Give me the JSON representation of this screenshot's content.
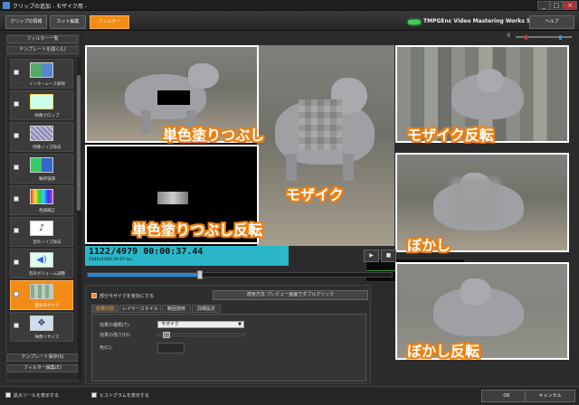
{
  "window": {
    "title": "クリップの追加 - モザイク用 -",
    "controls": [
      "_",
      "□",
      "×"
    ]
  },
  "header": {
    "tabs": [
      {
        "label": "クリップの情報",
        "active": false
      },
      {
        "label": "カット編集",
        "active": false
      },
      {
        "label": "フィルター",
        "active": true
      }
    ],
    "brand": "TMPGEnc Video Mastering Works 5",
    "help_label": "ヘルプ"
  },
  "sidebar": {
    "title": "フィルター一覧",
    "template_open_label": "テンプレートを開く(L)",
    "items": [
      {
        "label": "インターレース解除",
        "checked": false,
        "active": false,
        "thumb": "deinterlace"
      },
      {
        "label": "映像クロップ",
        "checked": false,
        "active": false,
        "thumb": "crop"
      },
      {
        "label": "映像ノイズ除去",
        "checked": false,
        "active": false,
        "thumb": "video-noise"
      },
      {
        "label": "輪郭強調",
        "checked": false,
        "active": false,
        "thumb": "sharpen"
      },
      {
        "label": "色調補正",
        "checked": false,
        "active": false,
        "thumb": "color"
      },
      {
        "label": "音声ノイズ除去",
        "checked": false,
        "active": false,
        "thumb": "audio-noise"
      },
      {
        "label": "音声ボリューム調整",
        "checked": false,
        "active": false,
        "thumb": "volume"
      },
      {
        "label": "部分モザイク",
        "checked": true,
        "active": true,
        "thumb": "mosaic"
      },
      {
        "label": "映像リサイズ",
        "checked": false,
        "active": false,
        "thumb": "resize"
      }
    ],
    "template_save_label": "テンプレート保存(S)",
    "filter_edit_label": "フィルター編集(E)"
  },
  "preview": {
    "captions": {
      "fill": "単色塗りつぶし",
      "mosaic_inverse": "モザイク反転",
      "mosaic": "モザイク",
      "fill_inverse": "単色塗りつぶし反転",
      "blur": "ぼかし",
      "blur_inverse": "ぼかし反転"
    }
  },
  "timecode": {
    "main": "1122/4979  00:00:37.44",
    "sub": "1440x1080 29.97 fps"
  },
  "transport": [
    "▶",
    "■",
    "◀◀",
    "▶▶",
    "◀|",
    "|▶"
  ],
  "seek": {
    "position": 0.37
  },
  "settings": {
    "enable_label": "部分モザイクを有効にする",
    "enabled": true,
    "apply_button": "適用方法:プレビュー画面でダブルクリック",
    "tabs": [
      "効果内容",
      "レイヤースタイル",
      "範囲適用",
      "詳細設定"
    ],
    "effect_type_label": "効果の種類(T):",
    "effect_type_value": "モザイク",
    "strength_label": "効果の強さ(D):",
    "strength": 0.05,
    "color_label": "色(C):"
  },
  "statusbar": {
    "zoom_tool_label": "拡大ツールを表示する",
    "histogram_label": "ヒストグラムを表示する",
    "ok_label": "OK",
    "cancel_label": "キャンセル"
  },
  "colors": {
    "accent": "#f28c16",
    "timecode_bg": "#2bb7c9",
    "caption_outline": "#f08010"
  }
}
